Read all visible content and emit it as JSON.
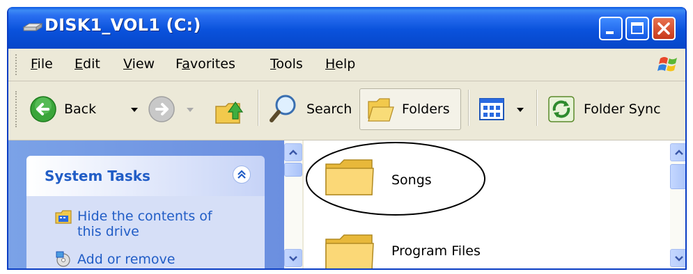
{
  "window": {
    "title": "DISK1_VOL1 (C:)"
  },
  "title_buttons": {
    "minimize": "minimize-icon",
    "maximize": "maximize-icon",
    "close": "close-icon"
  },
  "menubar": {
    "items": [
      {
        "label": "File",
        "accel": "F",
        "rest": "ile"
      },
      {
        "label": "Edit",
        "accel": "E",
        "rest": "dit"
      },
      {
        "label": "View",
        "accel": "V",
        "rest": "iew"
      },
      {
        "label": "Favorites",
        "pre": "F",
        "accel": "a",
        "rest": "vorites"
      },
      {
        "label": "Tools",
        "accel": "T",
        "rest": "ools"
      },
      {
        "label": "Help",
        "accel": "H",
        "rest": "elp"
      }
    ]
  },
  "toolbar": {
    "back_label": "Back",
    "search_label": "Search",
    "folders_label": "Folders",
    "folder_sync_label": "Folder Sync"
  },
  "task_pane": {
    "title": "System Tasks",
    "links": [
      {
        "text_line1": "Hide the contents of",
        "text_line2": "this drive"
      },
      {
        "text_line1": "Add or remove"
      }
    ]
  },
  "files": [
    {
      "name": "Songs",
      "icon": "folder-icon",
      "highlighted": true
    },
    {
      "name": "Program Files",
      "icon": "folder-icon"
    }
  ],
  "colors": {
    "titlebar": "#0a52dc",
    "taskpane": "#6b8fe0",
    "link": "#215dc6"
  }
}
